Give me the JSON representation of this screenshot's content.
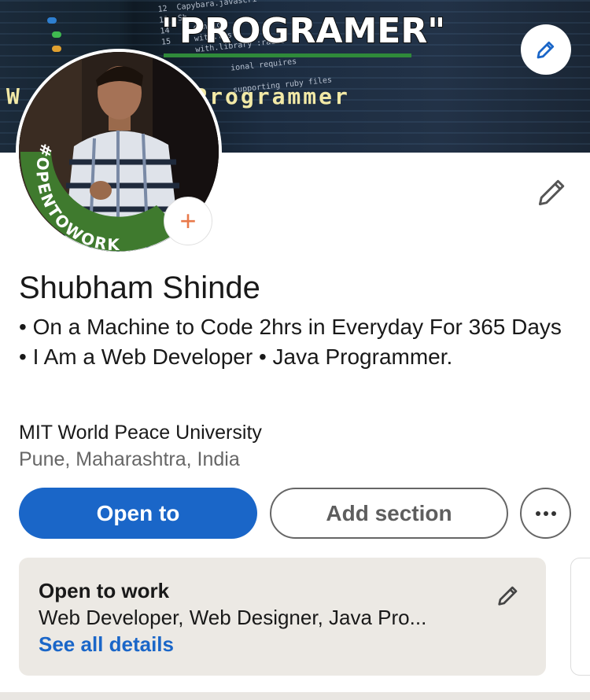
{
  "banner": {
    "title": "\"PROGRAMER\"",
    "subtitle": "W          per, Java Programmer",
    "edit_icon": "pencil-icon"
  },
  "avatar": {
    "badge_text": "#OPENTOWORK",
    "add_icon": "plus-icon",
    "add_symbol": "+"
  },
  "profile": {
    "name": "Shubham Shinde",
    "headline": "• On a Machine to Code 2hrs in Everyday For 365 Days • I Am a Web Developer • Java Programmer.",
    "education": "MIT World Peace University",
    "location": "Pune, Maharashtra, India",
    "edit_icon": "pencil-icon"
  },
  "actions": {
    "open_to": "Open to",
    "add_section": "Add section",
    "more_icon": "more-horizontal-icon"
  },
  "open_to_work": {
    "title": "Open to work",
    "roles": "Web Developer, Web Designer, Java Pro...",
    "link": "See all details",
    "edit_icon": "pencil-icon"
  },
  "colors": {
    "primary_blue": "#1a66c8",
    "open_to_work_green": "#3f7a2e",
    "add_orange": "#e8794a"
  }
}
